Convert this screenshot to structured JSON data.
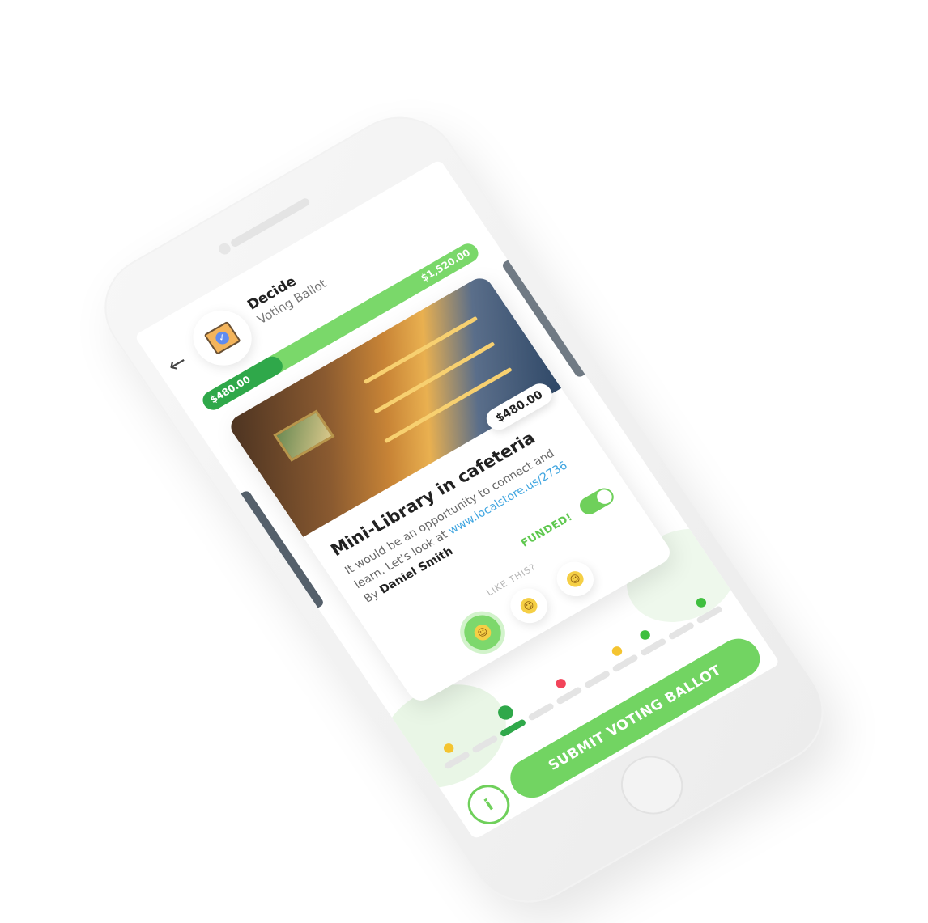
{
  "header": {
    "app_name": "Decide",
    "subtitle": "Voting Ballot"
  },
  "budget": {
    "spent": "$480.00",
    "total": "$1,520.00",
    "fill_fraction": 0.28
  },
  "card": {
    "price": "$480.00",
    "title": "Mini-Library in cafeteria",
    "desc_text": "It would be an opportunity to connect and learn. Let's look at ",
    "desc_link": "www.localstore.us/2736",
    "author_prefix": "By ",
    "author_name": "Daniel Smith",
    "funded_label": "FUNDED!",
    "funded_toggle_on": true,
    "like_label": "LIKE THIS?",
    "reactions": [
      {
        "name": "happy",
        "face": "☺",
        "selected": true
      },
      {
        "name": "neutral",
        "face": "☺",
        "selected": false
      },
      {
        "name": "smile",
        "face": "☺",
        "selected": false
      }
    ]
  },
  "timeline": {
    "status_dots": [
      "yellow",
      "gift",
      "red",
      "yellow",
      "green",
      "green"
    ],
    "colors": {
      "yellow": "#f4c430",
      "red": "#f2445a",
      "green": "#3fbf3f",
      "gift": "#2fa84a"
    }
  },
  "actions": {
    "info_label": "i",
    "submit_label": "SUBMIT VOTING BALLOT"
  },
  "colors": {
    "accent": "#72d462",
    "accent_dark": "#2fa84a",
    "link": "#3fa5e0"
  }
}
